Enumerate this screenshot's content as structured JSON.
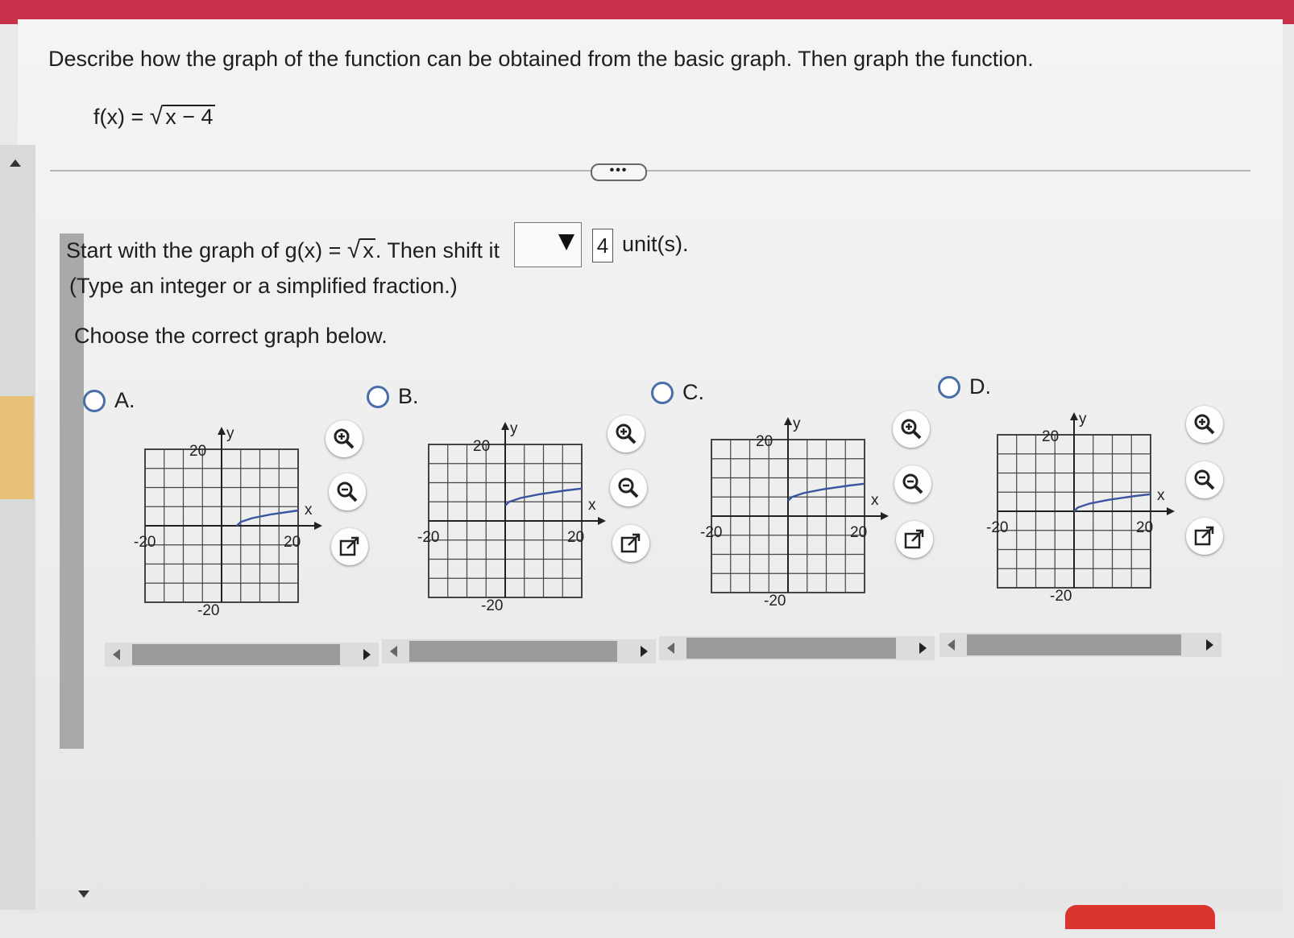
{
  "prompt": "Describe how the graph of the function can be obtained from the basic graph. Then graph the function.",
  "function": {
    "lhs": "f(x) = ",
    "radicand": "x − 4"
  },
  "more_button": "•••",
  "step": {
    "prefix": "Start with the graph of g(x) = ",
    "radicand": "x",
    "middle": ". Then shift it",
    "dropdown_value": "",
    "shift_value": "4",
    "unit_label": "unit(s).",
    "hint": "(Type an integer or a simplified fraction.)"
  },
  "choose_label": "Choose the correct graph below.",
  "options": [
    {
      "letter": "A.",
      "shift_x": 4,
      "shift_y": 0
    },
    {
      "letter": "B.",
      "shift_x": 0,
      "shift_y": 4
    },
    {
      "letter": "C.",
      "shift_x": 0,
      "shift_y": 4
    },
    {
      "letter": "D.",
      "shift_x": 0,
      "shift_y": 0
    }
  ],
  "graph_labels": {
    "xlabel": "x",
    "ylabel": "y",
    "tick_pos": "20",
    "tick_neg": "-20"
  },
  "icons": [
    "zoom-in-icon",
    "zoom-out-icon",
    "external-link-icon"
  ],
  "colors": {
    "header": "#c8304a",
    "curve": "#3a55a0",
    "radio": "#4a6fa8",
    "grid": "#444444"
  },
  "chart_data": [
    {
      "type": "line",
      "name": "A",
      "function": "sqrt(x-4)",
      "x": [
        4,
        5,
        8,
        13,
        20
      ],
      "y": [
        0,
        1,
        2,
        3,
        4
      ],
      "xlim": [
        -20,
        20
      ],
      "ylim": [
        -20,
        20
      ],
      "grid": true
    },
    {
      "type": "line",
      "name": "B",
      "function": "sqrt(x)+4",
      "x": [
        0,
        1,
        4,
        9,
        16,
        20
      ],
      "y": [
        4,
        5,
        6,
        7,
        8,
        8.47
      ],
      "xlim": [
        -20,
        20
      ],
      "ylim": [
        -20,
        20
      ],
      "grid": true
    },
    {
      "type": "line",
      "name": "C",
      "function": "sqrt(x)+4",
      "x": [
        0,
        1,
        4,
        9,
        16,
        20
      ],
      "y": [
        4,
        5,
        6,
        7,
        8,
        8.47
      ],
      "xlim": [
        -20,
        20
      ],
      "ylim": [
        -20,
        20
      ],
      "grid": true
    },
    {
      "type": "line",
      "name": "D",
      "function": "sqrt(x)",
      "x": [
        0,
        1,
        4,
        9,
        16,
        20
      ],
      "y": [
        0,
        1,
        2,
        3,
        4,
        4.47
      ],
      "xlim": [
        -20,
        20
      ],
      "ylim": [
        -20,
        20
      ],
      "grid": true
    }
  ]
}
